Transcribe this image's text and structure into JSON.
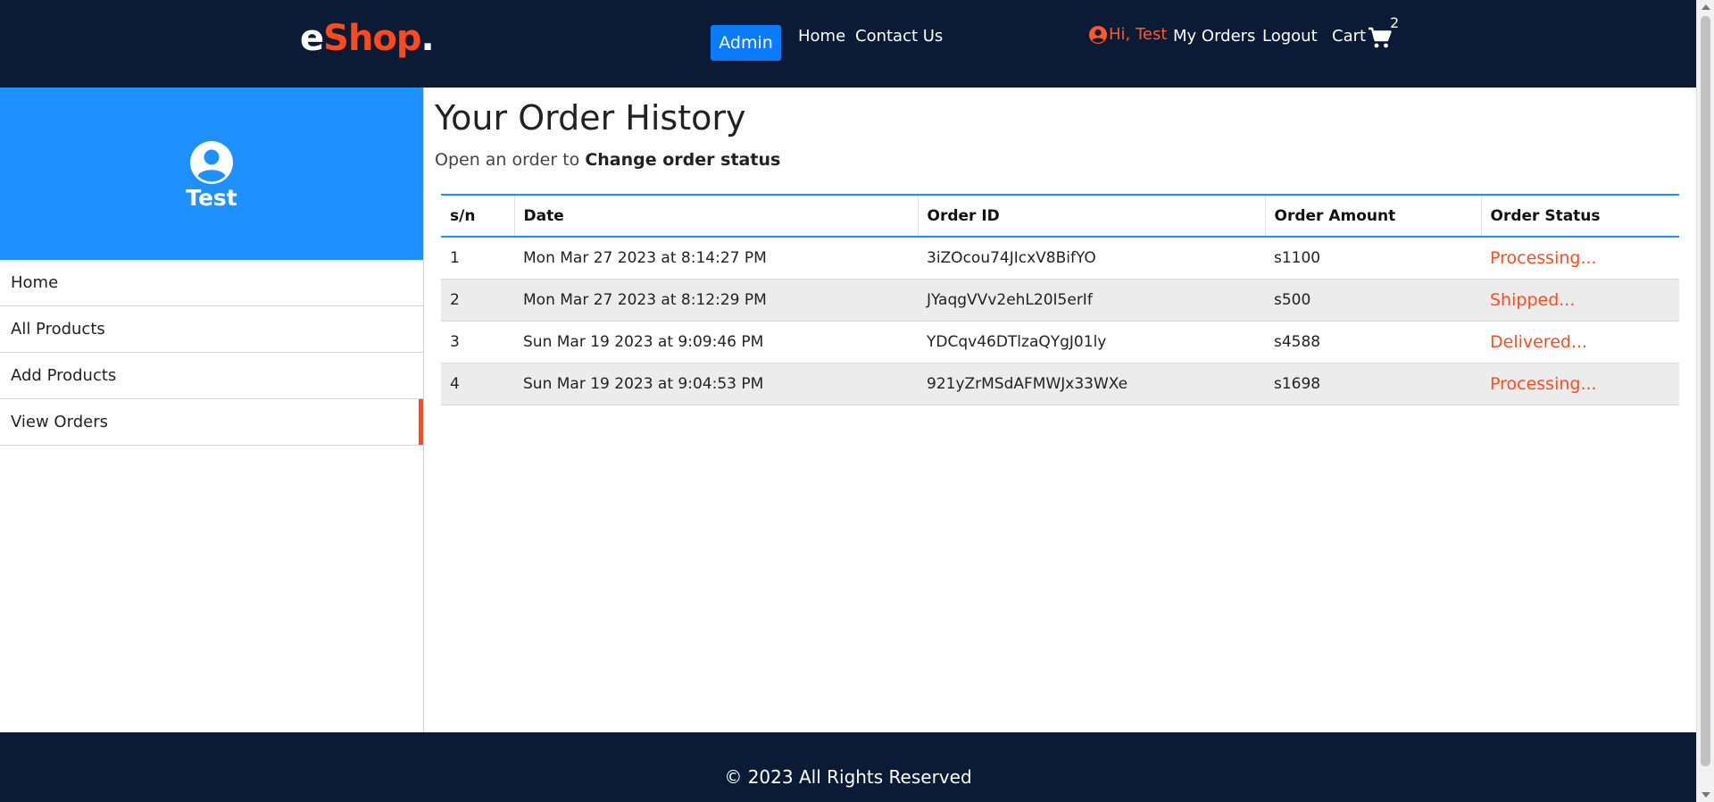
{
  "header": {
    "logo": {
      "e": "e",
      "shop": "Shop",
      "dot": "."
    },
    "admin_label": "Admin",
    "nav": {
      "home": "Home",
      "contact": "Contact Us"
    },
    "greeting": "Hi, Test",
    "my_orders": "My Orders",
    "logout": "Logout",
    "cart_label": "Cart",
    "cart_count": "2"
  },
  "sidebar": {
    "user_name": "Test",
    "items": [
      {
        "label": "Home"
      },
      {
        "label": "All Products"
      },
      {
        "label": "Add Products"
      },
      {
        "label": "View Orders"
      }
    ]
  },
  "main": {
    "title": "Your Order History",
    "subtitle_prefix": "Open an order to ",
    "subtitle_bold": "Change order status",
    "table": {
      "headers": [
        "s/n",
        "Date",
        "Order ID",
        "Order Amount",
        "Order Status"
      ],
      "rows": [
        {
          "sn": "1",
          "date": "Mon Mar 27 2023 at 8:14:27 PM",
          "id": "3iZOcou74JIcxV8BifYO",
          "amount": "s1100",
          "status": "Processing..."
        },
        {
          "sn": "2",
          "date": "Mon Mar 27 2023 at 8:12:29 PM",
          "id": "JYaqgVVv2ehL20I5erIf",
          "amount": "s500",
          "status": "Shipped..."
        },
        {
          "sn": "3",
          "date": "Sun Mar 19 2023 at 9:09:46 PM",
          "id": "YDCqv46DTlzaQYgJ01ly",
          "amount": "s4588",
          "status": "Delivered..."
        },
        {
          "sn": "4",
          "date": "Sun Mar 19 2023 at 9:04:53 PM",
          "id": "921yZrMSdAFMWJx33WXe",
          "amount": "s1698",
          "status": "Processing..."
        }
      ]
    }
  },
  "footer": {
    "text": "© 2023 All Rights Reserved"
  },
  "colors": {
    "nav_bg": "#0b1a35",
    "accent": "#ff4a1c",
    "primary": "#1e90ff",
    "admin_btn": "#0a7bff"
  }
}
